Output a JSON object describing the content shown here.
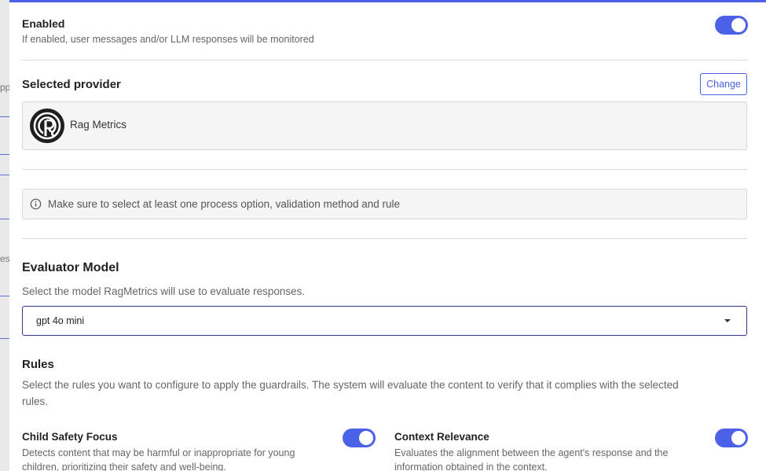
{
  "backdrop": {
    "fragments": [
      "pp",
      "es"
    ]
  },
  "monitoring": {
    "enabled_title": "Enabled",
    "enabled_desc": "If enabled, user messages and/or LLM responses will be monitored",
    "enabled": true
  },
  "provider": {
    "section_title": "Selected provider",
    "change_label": "Change",
    "name": "Rag Metrics",
    "logo_icon": "ragmetrics-logo-icon"
  },
  "notice": {
    "icon": "info-icon",
    "text": "Make sure to select at least one process option, validation method and rule"
  },
  "evaluator": {
    "title": "Evaluator Model",
    "desc": "Select the model RagMetrics will use to evaluate responses.",
    "selected": "gpt 4o mini"
  },
  "rules": {
    "title": "Rules",
    "desc_line1": "Select the rules you want to configure to apply the guardrails. The system will evaluate the content to verify that it complies with the selected",
    "desc_line2": "rules.",
    "items": [
      {
        "title": "Child Safety Focus",
        "desc_line1": "Detects content that may be harmful or inappropriate for young",
        "desc_line2": "children, prioritizing their safety and well-being.",
        "enabled": true
      },
      {
        "title": "Context Relevance",
        "desc_line1": "Evaluates the alignment between the agent's response and the",
        "desc_line2": "information obtained in the context.",
        "enabled": true
      }
    ]
  },
  "colors": {
    "accent": "#4a61e8",
    "select_border": "#2f3a8c",
    "box_bg": "#f5f5f5"
  }
}
